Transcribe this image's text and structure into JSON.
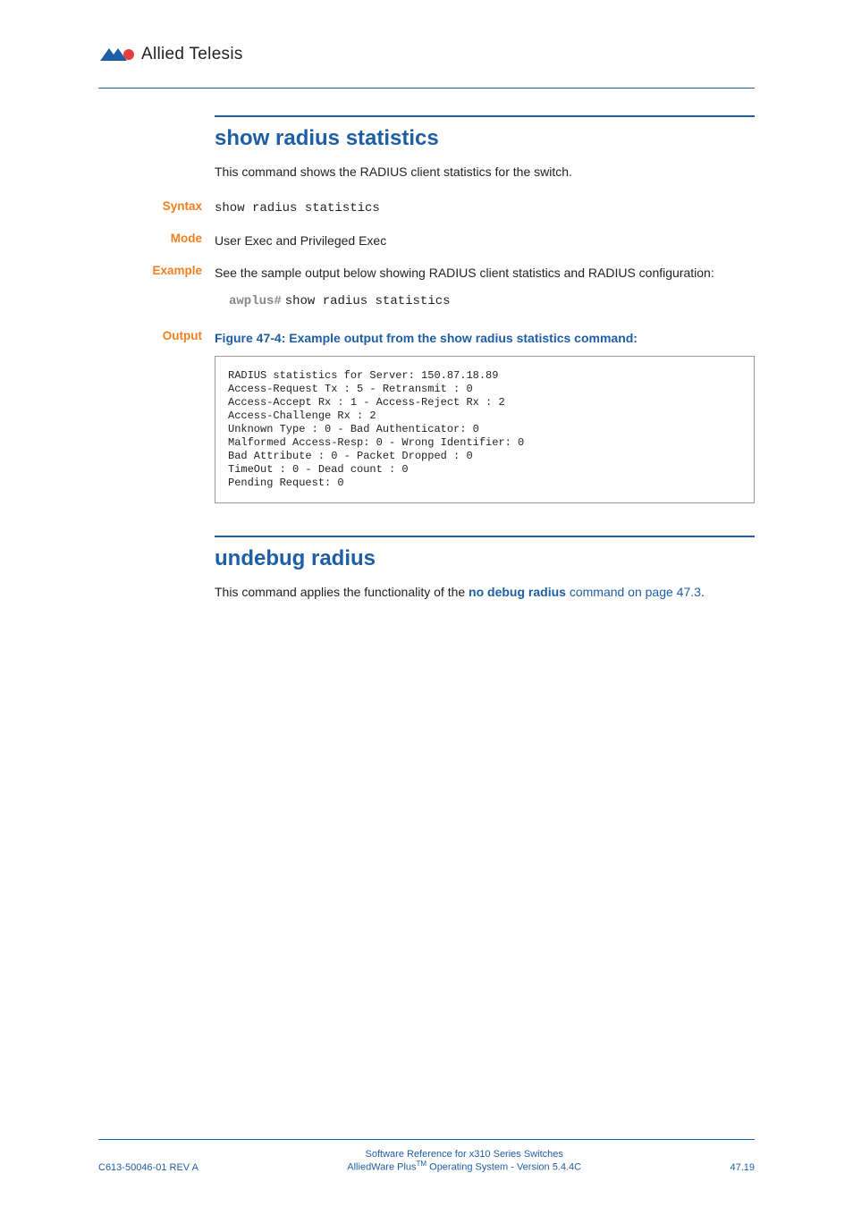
{
  "header": {
    "brand": "Allied Telesis"
  },
  "section1": {
    "title": "show radius statistics",
    "intro": "This command shows the RADIUS client statistics for the switch.",
    "syntax": {
      "label": "Syntax",
      "value": "show radius statistics"
    },
    "mode": {
      "label": "Mode",
      "value": "User Exec and Privileged Exec"
    },
    "example": {
      "label": "Example",
      "text": "See the sample output below showing RADIUS client statistics and RADIUS configuration:",
      "prompt": "awplus#",
      "cmd": "show radius statistics"
    },
    "output": {
      "label": "Output",
      "caption": "Figure 47-4: Example output from the show radius statistics command:",
      "lines": "RADIUS statistics for Server: 150.87.18.89\nAccess-Request Tx : 5 - Retransmit : 0\nAccess-Accept Rx : 1 - Access-Reject Rx : 2\nAccess-Challenge Rx : 2\nUnknown Type : 0 - Bad Authenticator: 0\nMalformed Access-Resp: 0 - Wrong Identifier: 0\nBad Attribute : 0 - Packet Dropped : 0\nTimeOut : 0 - Dead count : 0\nPending Request: 0"
    }
  },
  "section2": {
    "title": "undebug radius",
    "text_before": "This command applies the functionality of the ",
    "link_bold": "no debug radius",
    "link_rest": " command on page 47.3",
    "text_after": "."
  },
  "footer": {
    "left": "C613-50046-01 REV A",
    "center1": "Software Reference for x310 Series Switches",
    "center2a": "AlliedWare Plus",
    "center2b": "TM",
    "center2c": " Operating System - Version 5.4.4C",
    "right": "47.19"
  }
}
